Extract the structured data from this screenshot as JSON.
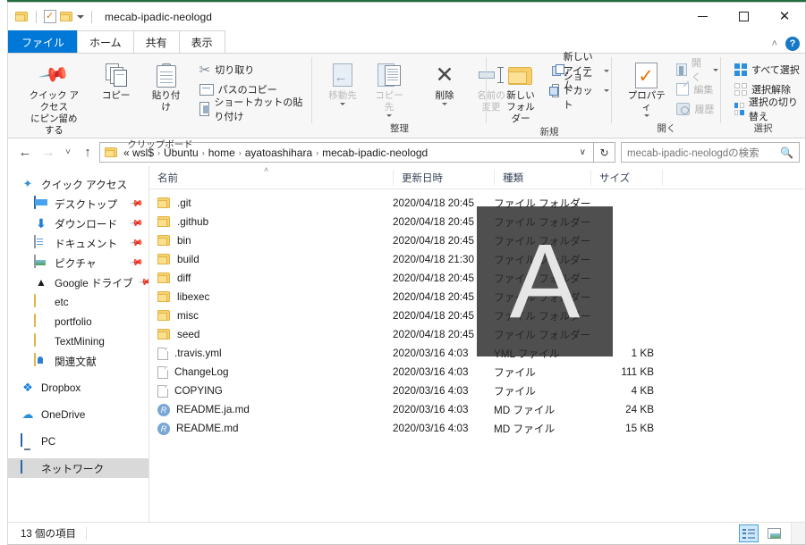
{
  "window": {
    "title": "mecab-ipadic-neologd",
    "quick_access_icons": [
      "folder-icon",
      "properties-icon",
      "folder-icon"
    ],
    "controls": {
      "minimize": "—",
      "maximize": "☐",
      "close": "✕"
    },
    "ribbon_collapse": "˄",
    "help": "?"
  },
  "tabs": [
    {
      "label": "ファイル",
      "name": "tab-file",
      "active": true
    },
    {
      "label": "ホーム",
      "name": "tab-home",
      "active": false
    },
    {
      "label": "共有",
      "name": "tab-share",
      "active": false
    },
    {
      "label": "表示",
      "name": "tab-view",
      "active": false
    }
  ],
  "ribbon": {
    "clipboard": {
      "group_title": "クリップボード",
      "pin_line1": "クイック アクセス",
      "pin_line2": "にピン留めする",
      "copy": "コピー",
      "paste": "貼り付け",
      "cut": "切り取り",
      "copy_path": "パスのコピー",
      "paste_shortcut": "ショートカットの貼り付け"
    },
    "organize": {
      "group_title": "整理",
      "move_to": "移動先",
      "copy_to": "コピー先",
      "delete": "削除",
      "rename_line1": "名前の",
      "rename_line2": "変更"
    },
    "new": {
      "group_title": "新規",
      "new_folder_line1": "新しい",
      "new_folder_line2": "フォルダー",
      "new_item": "新しいアイテム",
      "shortcut": "ショートカット"
    },
    "open": {
      "group_title": "開く",
      "properties": "プロパティ",
      "open": "開く",
      "edit": "編集",
      "history": "履歴"
    },
    "select": {
      "group_title": "選択",
      "select_all": "すべて選択",
      "select_none": "選択解除",
      "invert": "選択の切り替え"
    }
  },
  "address": {
    "back": "←",
    "forward": "→",
    "recent": "˅",
    "up": "↑",
    "crumbs": [
      "« wsl$",
      "Ubuntu",
      "home",
      "ayatoashihara",
      "mecab-ipadic-neologd"
    ],
    "separator": "›",
    "dropdown": "∨",
    "refresh": "↻",
    "search_placeholder": "mecab-ipadic-neologdの検索",
    "search_value": ""
  },
  "nav_pane": {
    "items": [
      {
        "label": "クイック アクセス",
        "icon": "star-icon",
        "indent": false,
        "pinned": false,
        "selected": false
      },
      {
        "label": "デスクトップ",
        "icon": "desktop-icon",
        "indent": true,
        "pinned": true,
        "selected": false
      },
      {
        "label": "ダウンロード",
        "icon": "download-icon",
        "indent": true,
        "pinned": true,
        "selected": false
      },
      {
        "label": "ドキュメント",
        "icon": "document-icon",
        "indent": true,
        "pinned": true,
        "selected": false
      },
      {
        "label": "ピクチャ",
        "icon": "picture-icon",
        "indent": true,
        "pinned": true,
        "selected": false
      },
      {
        "label": "Google ドライブ",
        "icon": "google-drive-icon",
        "indent": true,
        "pinned": true,
        "selected": false
      },
      {
        "label": "etc",
        "icon": "folder-icon",
        "indent": true,
        "pinned": false,
        "selected": false
      },
      {
        "label": "portfolio",
        "icon": "folder-icon",
        "indent": true,
        "pinned": false,
        "selected": false
      },
      {
        "label": "TextMining",
        "icon": "folder-icon",
        "indent": true,
        "pinned": false,
        "selected": false
      },
      {
        "label": "関連文献",
        "icon": "user-folder-icon",
        "indent": true,
        "pinned": false,
        "selected": false
      },
      {
        "label": "Dropbox",
        "icon": "dropbox-icon",
        "indent": false,
        "pinned": false,
        "selected": false
      },
      {
        "label": "OneDrive",
        "icon": "onedrive-icon",
        "indent": false,
        "pinned": false,
        "selected": false
      },
      {
        "label": "PC",
        "icon": "pc-icon",
        "indent": false,
        "pinned": false,
        "selected": false
      },
      {
        "label": "ネットワーク",
        "icon": "network-icon",
        "indent": false,
        "pinned": false,
        "selected": true
      }
    ]
  },
  "file_list": {
    "columns": [
      {
        "label": "名前",
        "name": "column-name"
      },
      {
        "label": "更新日時",
        "name": "column-date-modified"
      },
      {
        "label": "種類",
        "name": "column-type"
      },
      {
        "label": "サイズ",
        "name": "column-size"
      }
    ],
    "sort_indicator": "˄",
    "rows": [
      {
        "name": ".git",
        "date": "2020/04/18 20:45",
        "type": "ファイル フォルダー",
        "size": "",
        "icon": "folder-icon"
      },
      {
        "name": ".github",
        "date": "2020/04/18 20:45",
        "type": "ファイル フォルダー",
        "size": "",
        "icon": "folder-icon"
      },
      {
        "name": "bin",
        "date": "2020/04/18 20:45",
        "type": "ファイル フォルダー",
        "size": "",
        "icon": "folder-icon"
      },
      {
        "name": "build",
        "date": "2020/04/18 21:30",
        "type": "ファイル フォルダー",
        "size": "",
        "icon": "folder-icon"
      },
      {
        "name": "diff",
        "date": "2020/04/18 20:45",
        "type": "ファイル フォルダー",
        "size": "",
        "icon": "folder-icon"
      },
      {
        "name": "libexec",
        "date": "2020/04/18 20:45",
        "type": "ファイル フォルダー",
        "size": "",
        "icon": "folder-icon"
      },
      {
        "name": "misc",
        "date": "2020/04/18 20:45",
        "type": "ファイル フォルダー",
        "size": "",
        "icon": "folder-icon"
      },
      {
        "name": "seed",
        "date": "2020/04/18 20:45",
        "type": "ファイル フォルダー",
        "size": "",
        "icon": "folder-icon"
      },
      {
        "name": ".travis.yml",
        "date": "2020/03/16 4:03",
        "type": "YML ファイル",
        "size": "1 KB",
        "icon": "file-icon"
      },
      {
        "name": "ChangeLog",
        "date": "2020/03/16 4:03",
        "type": "ファイル",
        "size": "111 KB",
        "icon": "file-icon"
      },
      {
        "name": "COPYING",
        "date": "2020/03/16 4:03",
        "type": "ファイル",
        "size": "4 KB",
        "icon": "file-icon"
      },
      {
        "name": "README.ja.md",
        "date": "2020/03/16 4:03",
        "type": "MD ファイル",
        "size": "24 KB",
        "icon": "md-file-icon"
      },
      {
        "name": "README.md",
        "date": "2020/03/16 4:03",
        "type": "MD ファイル",
        "size": "15 KB",
        "icon": "md-file-icon"
      }
    ]
  },
  "overlay": {
    "letter": "A"
  },
  "status_bar": {
    "item_count": "13 個の項目",
    "view_details": "details-view",
    "view_large_icons": "large-icons-view"
  },
  "colors": {
    "accent": "#0078d7",
    "selection": "#d9d9d9",
    "folder": "#fbdf8d",
    "overlay": "#282828",
    "ribbon_bg": "#f7f7f7"
  }
}
